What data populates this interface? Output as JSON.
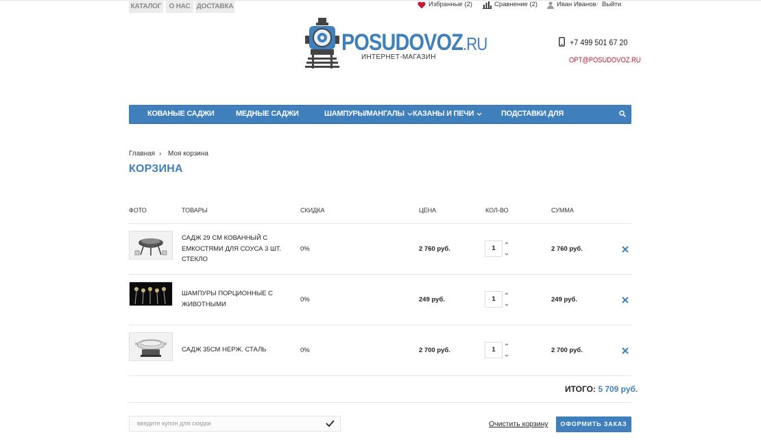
{
  "top_tabs": [
    "Каталог",
    "О нас",
    "Доставка"
  ],
  "top_links": {
    "favorites": "Избранные (2)",
    "compare": "Сравнение (2)",
    "user": "Иван Иванов",
    "separator": "/",
    "logout": "Выйти"
  },
  "logo": {
    "brand": "POSUDOVOZ",
    "tld": ".RU",
    "subtitle": "ИНТЕРНЕТ-МАГАЗИН"
  },
  "contacts": {
    "phone": "+7 499 501 67 20",
    "email": "opt@posudovoz.ru"
  },
  "nav": {
    "items": [
      "Кованые саджи",
      "Медные саджи",
      "Шампуры/мангалы",
      "Казаны и печи",
      "Подставки для"
    ]
  },
  "breadcrumb": {
    "home": "Главная",
    "separator": "›",
    "current": "Моя корзина"
  },
  "page_title": "Корзина",
  "table": {
    "headers": [
      "Фото",
      "Товары",
      "Скидка",
      "Цена",
      "Кол-во",
      "Сумма"
    ],
    "rows": [
      {
        "name": "Садж 29 см кованный с емкостями для соуса 3 шт. стекло",
        "discount": "0%",
        "price": "2 760 руб.",
        "qty": "1",
        "sum": "2 760 руб."
      },
      {
        "name": "Шампуры порционные с животными",
        "discount": "0%",
        "price": "249 руб.",
        "qty": "1",
        "sum": "249 руб."
      },
      {
        "name": "Садж 35см нерж. сталь",
        "discount": "0%",
        "price": "2 700 руб.",
        "qty": "1",
        "sum": "2 700 руб."
      }
    ]
  },
  "total": {
    "label": "ИТОГО:",
    "value": "5 709 руб."
  },
  "coupon": {
    "placeholder": "введите купон для скидки"
  },
  "actions": {
    "clear": "Очистить корзину",
    "checkout": "Оформить заказ"
  },
  "colors": {
    "accent": "#3f7fbc",
    "email": "#c01a36"
  }
}
